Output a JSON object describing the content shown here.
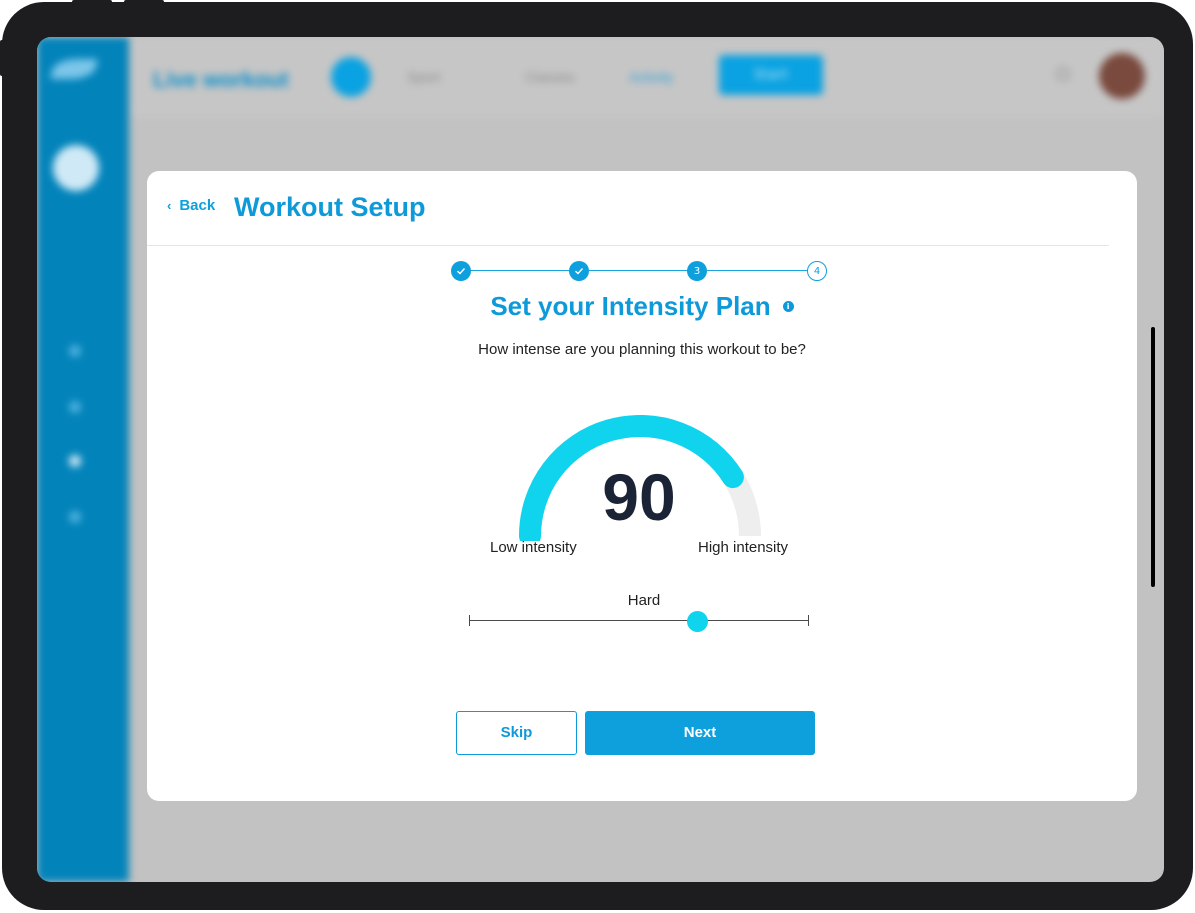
{
  "background_app": {
    "title": "Live workout",
    "dropdown_1": "Sport",
    "dropdown_2": "Classes",
    "link": "Activity",
    "button": "Start"
  },
  "modal": {
    "back_label": "Back",
    "title": "Workout Setup"
  },
  "stepper": {
    "steps": [
      {
        "state": "done",
        "label": ""
      },
      {
        "state": "done",
        "label": ""
      },
      {
        "state": "current",
        "label": "3"
      },
      {
        "state": "todo",
        "label": "4"
      }
    ]
  },
  "intensity": {
    "heading": "Set your Intensity Plan",
    "question": "How intense are you planning this workout to be?",
    "value": "90",
    "gauge_fraction": 0.82,
    "low_label": "Low intensity",
    "high_label": "High intensity",
    "level_label": "Hard",
    "slider_fraction": 0.67
  },
  "actions": {
    "skip_label": "Skip",
    "next_label": "Next"
  },
  "colors": {
    "accent": "#0ea0dd",
    "gauge_fill": "#10d3ee",
    "gauge_track": "#eeeeee",
    "sidebar": "#0283ba"
  }
}
